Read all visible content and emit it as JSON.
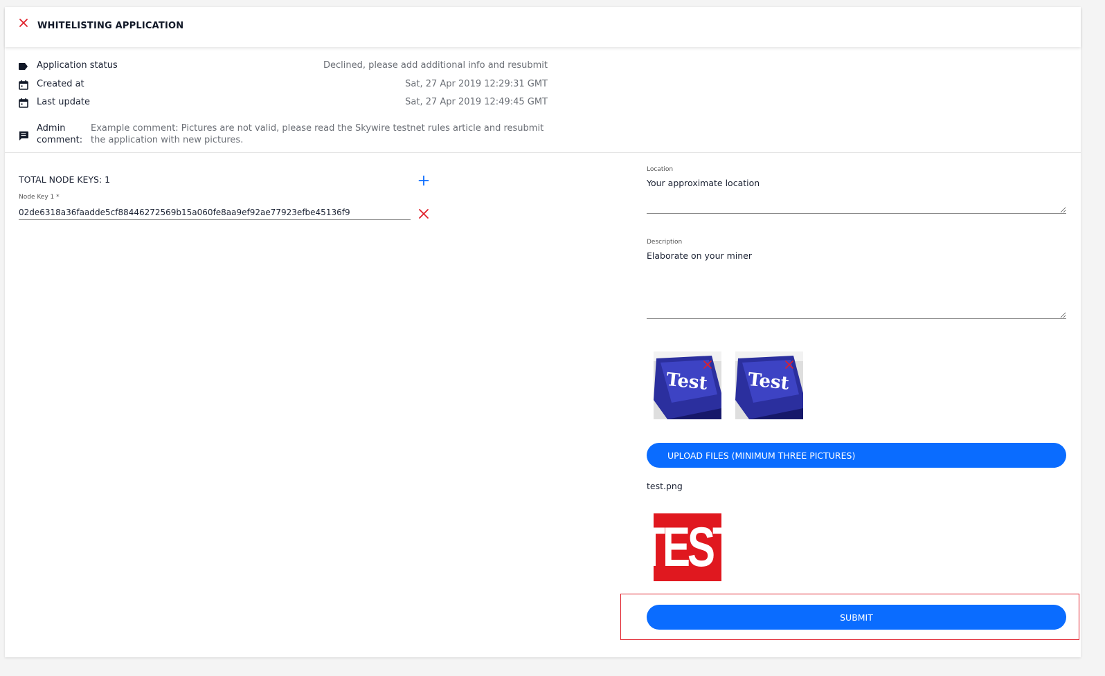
{
  "header": {
    "title": "WHITELISTING APPLICATION"
  },
  "info": {
    "status": {
      "label": "Application status",
      "value": "Declined, please add additional info and resubmit",
      "icon": "tag-icon"
    },
    "created": {
      "label": "Created at",
      "value": "Sat, 27 Apr 2019 12:29:31 GMT",
      "icon": "calendar-icon"
    },
    "updated": {
      "label": "Last update",
      "value": "Sat, 27 Apr 2019 12:49:45 GMT",
      "icon": "calendar-icon"
    },
    "admin": {
      "label_line1": "Admin",
      "label_line2": "comment:",
      "comment": "Example comment: Pictures are not valid, please read the Skywire testnet rules article and resubmit the application with new pictures.",
      "icon": "comment-icon"
    }
  },
  "nodes": {
    "total_label": "TOTAL NODE KEYS: 1",
    "keys": [
      {
        "label": "Node Key 1 *",
        "value": "02de6318a36faadde5cf88446272569b15a060fe8aa9ef92ae77923efbe45136f9"
      }
    ]
  },
  "form": {
    "location": {
      "label": "Location",
      "placeholder": "Your approximate location"
    },
    "description": {
      "label": "Description",
      "placeholder": "Elaborate on your miner"
    },
    "existing_images": [
      {
        "text": "Test"
      },
      {
        "text": "Test"
      }
    ],
    "upload_label": "UPLOAD FILES (MINIMUM THREE PICTURES)",
    "uploaded_file": "test.png",
    "uploaded_preview_text": "TEST",
    "submit_label": "SUBMIT"
  },
  "colors": {
    "accent": "#0a6cff",
    "danger": "#e0202a",
    "text": "#1b2233",
    "muted": "#6b6f76"
  }
}
